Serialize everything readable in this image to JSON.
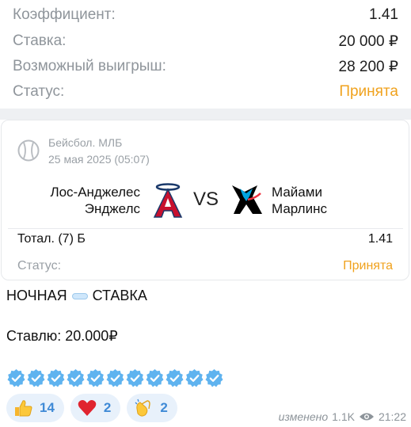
{
  "summary": {
    "rows": [
      {
        "label": "Коэффициент:",
        "value": "1.41"
      },
      {
        "label": "Ставка:",
        "value": "20 000 ₽"
      },
      {
        "label": "Возможный выигрыш:",
        "value": "28 200 ₽"
      },
      {
        "label": "Статус:",
        "value": "Принята"
      }
    ]
  },
  "card": {
    "sport_icon": "baseball-icon",
    "league": "Бейсбол. МЛБ",
    "datetime": "25 мая 2025 (05:07)",
    "team1": {
      "line1": "Лос-Анджелес",
      "line2": "Энджелс",
      "logo": "angels-logo"
    },
    "vs": "VS",
    "team2": {
      "line1": "Майами",
      "line2": "Марлинс",
      "logo": "marlins-logo"
    },
    "market": "Тотал. (7) Б",
    "odds": "1.41",
    "status_label": "Статус:",
    "status_value": "Принята"
  },
  "message": {
    "title_left": "НОЧНАЯ",
    "title_right": "СТАВКА",
    "bet_text": "Ставлю: 20.000₽",
    "badge_count": 11
  },
  "reactions": [
    {
      "emoji": "thumbs-up",
      "count": "14"
    },
    {
      "emoji": "heart",
      "count": "2"
    },
    {
      "emoji": "clapping-hands",
      "count": "2"
    }
  ],
  "meta": {
    "edited": "изменено",
    "views": "1.1K",
    "time": "21:22"
  },
  "colors": {
    "accent": "#f0a21e",
    "reaction_text": "#3f8ad6",
    "muted": "#8f959b"
  }
}
